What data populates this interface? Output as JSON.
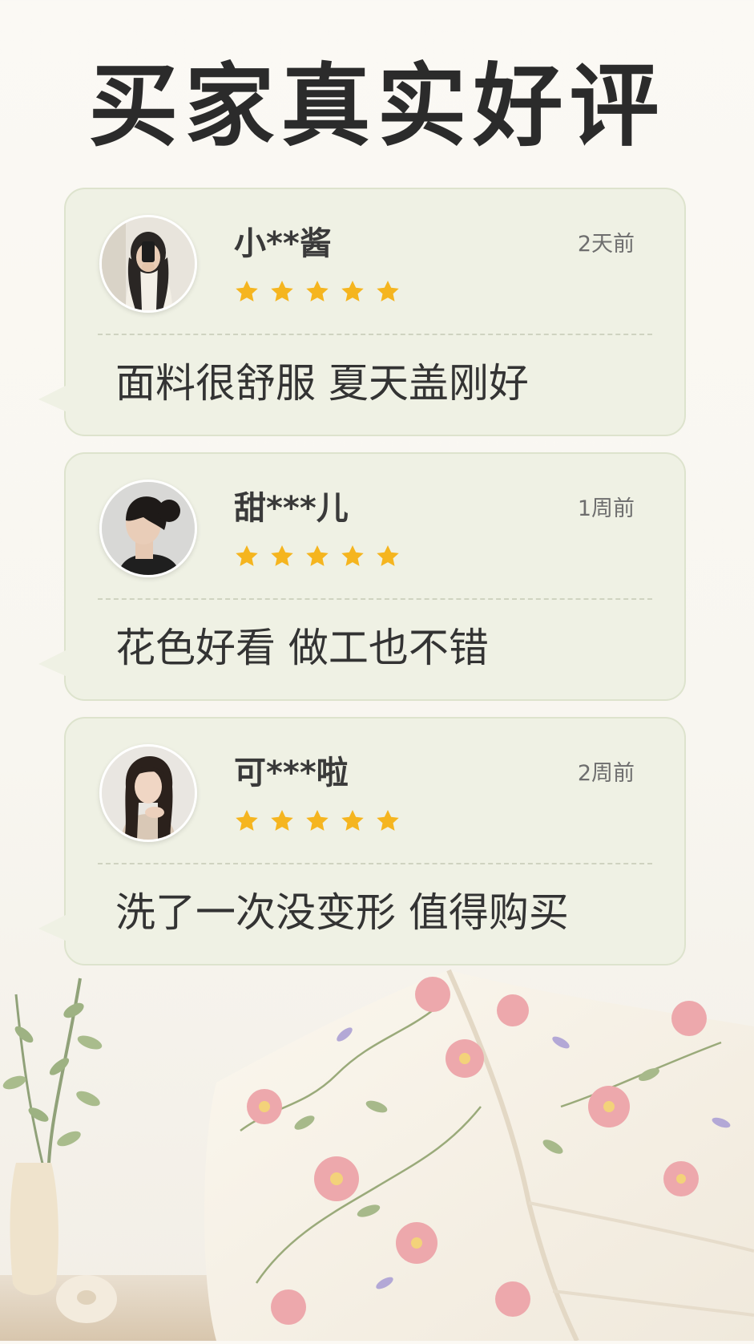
{
  "page": {
    "title": "买家真实好评"
  },
  "reviews": [
    {
      "username": "小**酱",
      "time": "2天前",
      "rating": 5,
      "text": "面料很舒服 夏天盖刚好",
      "avatar": "avatar-phone-selfie"
    },
    {
      "username": "甜***儿",
      "time": "1周前",
      "rating": 5,
      "text": "花色好看 做工也不错",
      "avatar": "avatar-hair-bun-profile"
    },
    {
      "username": "可***啦",
      "time": "2周前",
      "rating": 5,
      "text": "洗了一次没变形 值得购买",
      "avatar": "avatar-long-hair-portrait"
    }
  ],
  "colors": {
    "card_bg": "#eff1e4",
    "card_border": "#dde3cd",
    "star": "#f5b51f",
    "title": "#2b2b2b",
    "quilt_flower": "#e9a3a6"
  },
  "icons": {
    "star": "star-icon",
    "tail": "speech-bubble-tail"
  }
}
